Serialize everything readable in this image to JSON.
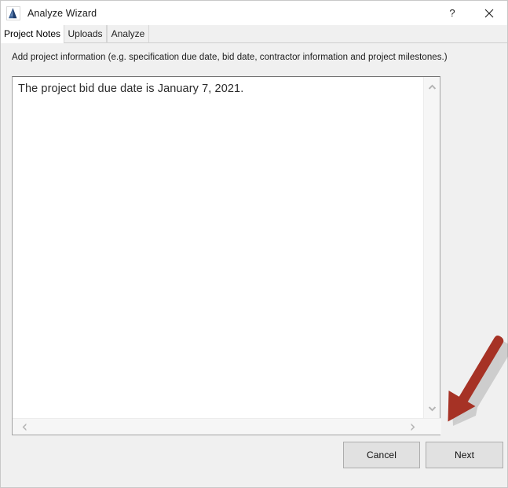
{
  "window": {
    "title": "Analyze Wizard",
    "icon": "analyze-app-icon",
    "help_label": "?",
    "close_label": "✕"
  },
  "tabs": [
    {
      "id": "project-notes",
      "label": "Project Notes",
      "active": true
    },
    {
      "id": "uploads",
      "label": "Uploads",
      "active": false
    },
    {
      "id": "analyze",
      "label": "Analyze",
      "active": false
    }
  ],
  "main": {
    "instruction": "Add project information (e.g. specification due date, bid date, contractor information and project milestones.)",
    "notes_value": "The project bid due date is January 7, 2021.",
    "notes_placeholder": "",
    "scrollbars": {
      "vertical": {
        "up_icon": "chevron-up-icon",
        "down_icon": "chevron-down-icon"
      },
      "horizontal": {
        "left_icon": "chevron-left-icon",
        "right_icon": "chevron-right-icon"
      }
    }
  },
  "footer": {
    "cancel_label": "Cancel",
    "next_label": "Next"
  },
  "annotation": {
    "type": "arrow",
    "points_to": "next-button",
    "color": "#a63225"
  },
  "colors": {
    "window_bg": "#f0f0f0",
    "titlebar_bg": "#ffffff",
    "field_bg": "#ffffff",
    "button_bg": "#e1e1e1",
    "button_border": "#adadad",
    "accent_icon": "#2a4d80",
    "annotation_red": "#a63225"
  }
}
